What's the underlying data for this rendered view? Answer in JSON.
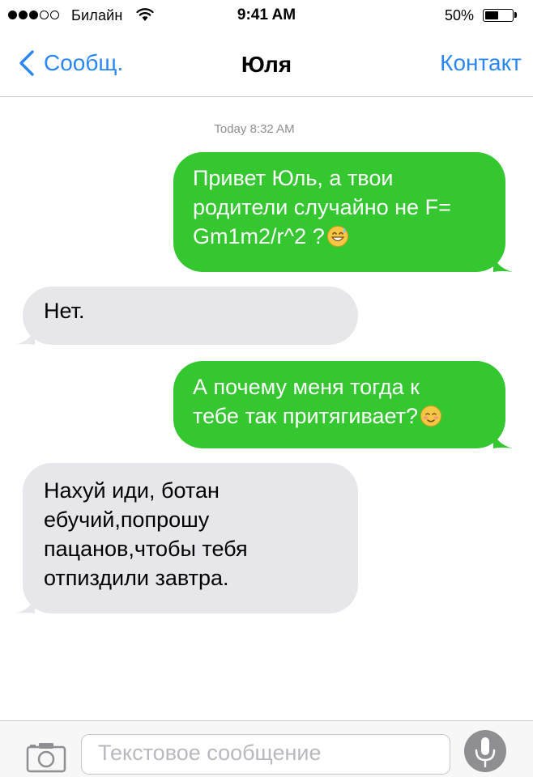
{
  "status_bar": {
    "carrier": "Билайн",
    "time": "9:41 AM",
    "battery_percent": "50%",
    "battery_level": 0.5,
    "signal_bars_filled": 3,
    "signal_bars_total": 5
  },
  "nav": {
    "back_label": "Сообщ.",
    "title": "Юля",
    "contact_label": "Контакт"
  },
  "conversation": {
    "timestamp": "Today 8:32 AM",
    "messages": [
      {
        "direction": "outgoing",
        "text": "Привет Юль, а твои\nродители случайно не F=\nGm1m2/r^2 ?",
        "emoji": "grinning-sweat-emoji"
      },
      {
        "direction": "incoming",
        "text": "Нет."
      },
      {
        "direction": "outgoing",
        "text": "А почему меня тогда к\nтебе так притягивает?",
        "emoji": "smiling-blush-emoji"
      },
      {
        "direction": "incoming",
        "text": "Нахуй иди, ботан\nебучий,попрошу\nпацанов,чтобы тебя\nотпиздили завтра."
      }
    ]
  },
  "input": {
    "placeholder": "Текстовое сообщение"
  },
  "colors": {
    "accent_blue": "#2a87f5",
    "outgoing_bubble": "#35c72f",
    "incoming_bubble": "#e6e6eb"
  },
  "icons": {
    "back": "chevron-left-icon",
    "camera": "camera-icon",
    "mic": "microphone-icon",
    "wifi": "wifi-icon"
  }
}
